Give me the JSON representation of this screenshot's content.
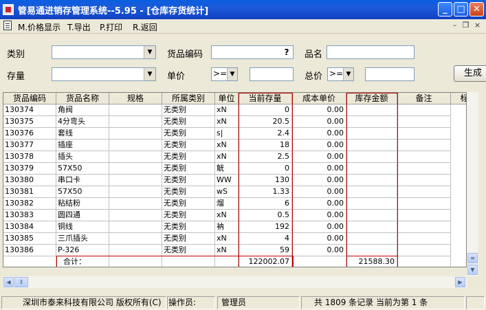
{
  "window": {
    "title": "管易通进销存管理系统--5.95 - [仓库存货统计]",
    "min_glyph": "_",
    "max_glyph": "□",
    "close_glyph": "✕"
  },
  "menu": [
    {
      "label": "M.价格显示"
    },
    {
      "label": "T.导出"
    },
    {
      "label": "P.打印"
    },
    {
      "label": "R.返回"
    }
  ],
  "mdi": {
    "min": "–",
    "restore": "❐",
    "close": "×"
  },
  "filters": {
    "category_label": "类别",
    "code_label": "货品编码",
    "code_btn": "?",
    "name_label": "品名",
    "stock_label": "存量",
    "price_label": "单价",
    "price_op": ">=",
    "total_label": "总价",
    "total_op": ">=",
    "generate_btn": "生成"
  },
  "table": {
    "columns": [
      "货品编码",
      "货品名称",
      "规格",
      "所属类别",
      "单位",
      "当前存量",
      "成本单价",
      "库存金额",
      "备注",
      "标"
    ],
    "rows": [
      [
        "130374",
        "角阀",
        "",
        "无类别",
        "xN",
        "0",
        "0.00",
        "",
        ""
      ],
      [
        "130375",
        "4分弯头",
        "",
        "无类别",
        "xN",
        "20.5",
        "0.00",
        "",
        ""
      ],
      [
        "130376",
        "套线",
        "",
        "无类别",
        "s|",
        "2.4",
        "0.00",
        "",
        ""
      ],
      [
        "130377",
        "插座",
        "",
        "无类别",
        "xN",
        "18",
        "0.00",
        "",
        ""
      ],
      [
        "130378",
        "插头",
        "",
        "无类别",
        "xN",
        "2.5",
        "0.00",
        "",
        ""
      ],
      [
        "130379",
        "57X50",
        "",
        "无类别",
        "觥",
        "0",
        "0.00",
        "",
        ""
      ],
      [
        "130380",
        "串口卡",
        "",
        "无类别",
        "WW",
        "130",
        "0.00",
        "",
        ""
      ],
      [
        "130381",
        "57X50",
        "",
        "无类别",
        "wS",
        "1.33",
        "0.00",
        "",
        ""
      ],
      [
        "130382",
        "粘结粉",
        "",
        "无类别",
        "熘",
        "6",
        "0.00",
        "",
        ""
      ],
      [
        "130383",
        "圆四通",
        "",
        "无类别",
        "xN",
        "0.5",
        "0.00",
        "",
        ""
      ],
      [
        "130384",
        "铜线",
        "",
        "无类别",
        "衲",
        "192",
        "0.00",
        "",
        ""
      ],
      [
        "130385",
        "三爪插头",
        "",
        "无类别",
        "xN",
        "4",
        "0.00",
        "",
        ""
      ],
      [
        "130386",
        "P-326",
        "",
        "无类别",
        "xN",
        "59",
        "0.00",
        "",
        ""
      ]
    ],
    "total_row": {
      "label": "合计：",
      "qty": "122002.07",
      "amount": "21588.30"
    }
  },
  "status": {
    "company": "深圳市泰来科技有限公司 版权所有(C)",
    "operator_label": "操作员:",
    "operator": "管理员",
    "records": "共 1809 条记录 当前为第 1 条"
  }
}
